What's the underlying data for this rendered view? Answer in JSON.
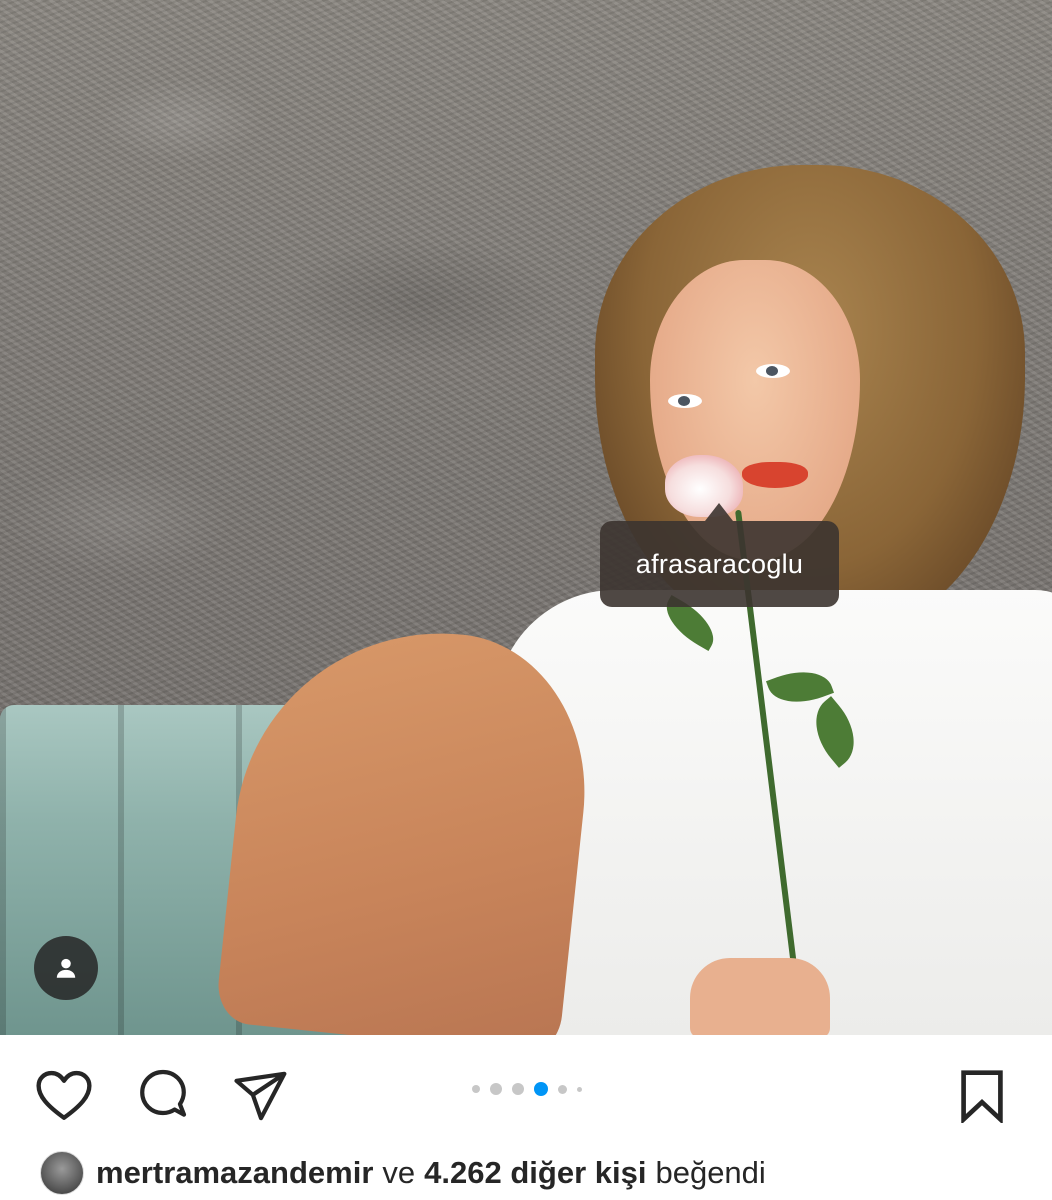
{
  "photo": {
    "tag_username": "afrasaracoglu"
  },
  "actions": {
    "icons": [
      "heart-icon",
      "comment-icon",
      "share-icon",
      "bookmark-icon"
    ],
    "carousel": {
      "total": 6,
      "active_index": 3
    },
    "active_dot_color": "#0095f6"
  },
  "likes": {
    "username": "mertramazandemir",
    "connector": "ve",
    "others": "4.262 diğer kişi",
    "suffix": "beğendi"
  }
}
